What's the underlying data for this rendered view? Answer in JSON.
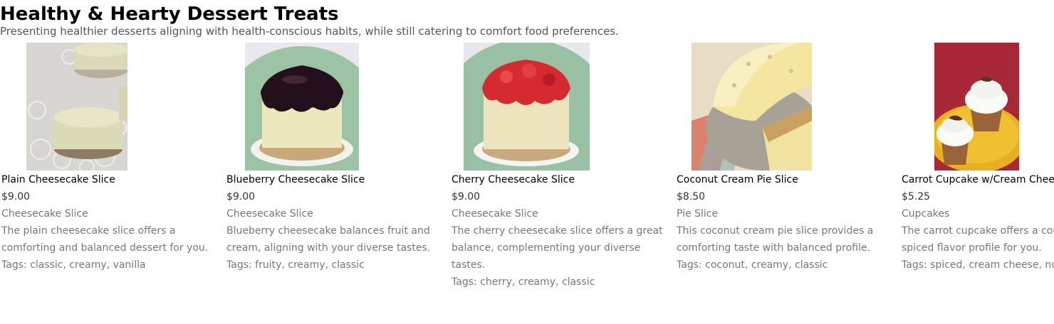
{
  "header": {
    "title": "Healthy & Hearty Dessert Treats",
    "subtitle": "Presenting healthier desserts aligning with health-conscious habits, while still catering to comfort food preferences."
  },
  "products": [
    {
      "name": "Plain Cheesecake Slice",
      "price": "$9.00",
      "category": "Cheesecake Slice",
      "description": "The plain cheesecake slice offers a comforting and balanced dessert for you.",
      "tags": "Tags: classic, creamy, vanilla"
    },
    {
      "name": "Blueberry Cheesecake Slice",
      "price": "$9.00",
      "category": "Cheesecake Slice",
      "description": "Blueberry cheesecake balances fruit and cream, aligning with your diverse tastes.",
      "tags": "Tags: fruity, creamy, classic"
    },
    {
      "name": "Cherry Cheesecake Slice",
      "price": "$9.00",
      "category": "Cheesecake Slice",
      "description": "The cherry cheesecake slice offers a great balance, complementing your diverse tastes.",
      "tags": "Tags: cherry, creamy, classic"
    },
    {
      "name": "Coconut Cream Pie Slice",
      "price": "$8.50",
      "category": "Pie Slice",
      "description": "This coconut cream pie slice provides a comforting taste with balanced profile.",
      "tags": "Tags: coconut, creamy, classic"
    },
    {
      "name": "Carrot Cupcake w/Cream Cheese Frosting",
      "price": "$5.25",
      "category": "Cupcakes",
      "description": "The carrot cupcake offers a comforting spiced flavor profile for you.",
      "tags": "Tags: spiced, cream cheese, nuts"
    }
  ]
}
